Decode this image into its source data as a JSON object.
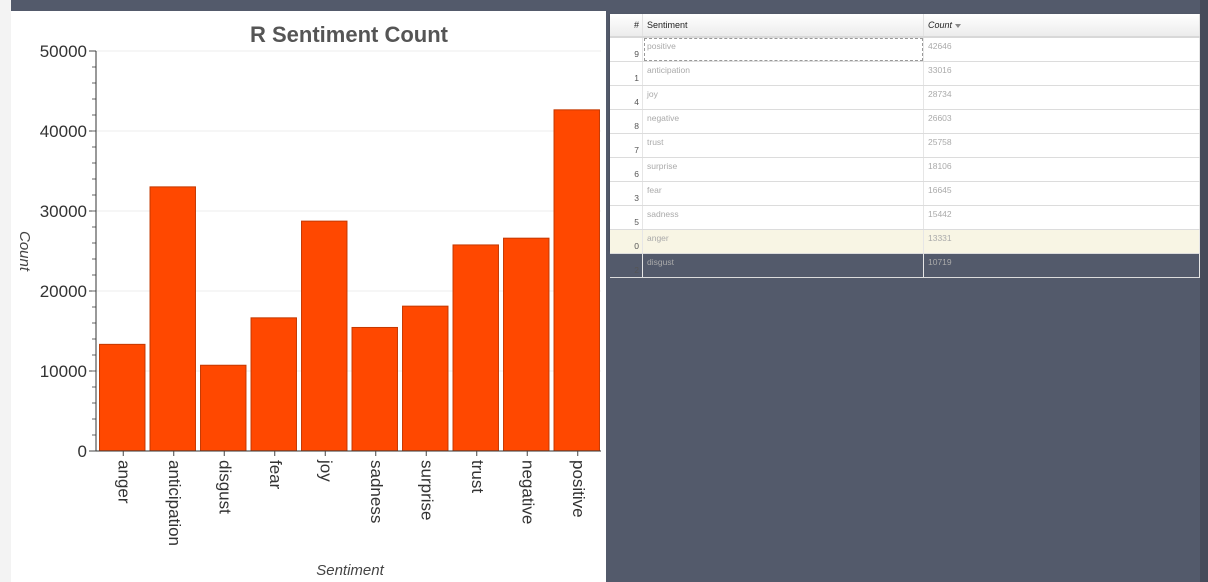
{
  "chart_data": {
    "type": "bar",
    "title": "R Sentiment Count",
    "xlabel": "Sentiment",
    "ylabel": "Count",
    "categories": [
      "anger",
      "anticipation",
      "disgust",
      "fear",
      "joy",
      "sadness",
      "surprise",
      "trust",
      "negative",
      "positive"
    ],
    "values": [
      13331,
      33016,
      10719,
      16645,
      28734,
      15442,
      18106,
      25758,
      26603,
      42646
    ],
    "ylim": [
      0,
      50000
    ],
    "yticks": [
      "0",
      "10000",
      "20000",
      "30000",
      "40000",
      "50000"
    ],
    "grid": true,
    "colors": {
      "bar": "#ff4800"
    }
  },
  "table": {
    "headers": {
      "index": "#",
      "sentiment": "Sentiment",
      "count": "Count"
    },
    "rows": [
      {
        "index": "9",
        "sentiment": "positive",
        "count": "42646"
      },
      {
        "index": "1",
        "sentiment": "anticipation",
        "count": "33016"
      },
      {
        "index": "4",
        "sentiment": "joy",
        "count": "28734"
      },
      {
        "index": "8",
        "sentiment": "negative",
        "count": "26603"
      },
      {
        "index": "7",
        "sentiment": "trust",
        "count": "25758"
      },
      {
        "index": "6",
        "sentiment": "surprise",
        "count": "18106"
      },
      {
        "index": "3",
        "sentiment": "fear",
        "count": "16645"
      },
      {
        "index": "5",
        "sentiment": "sadness",
        "count": "15442"
      },
      {
        "index": "0",
        "sentiment": "anger",
        "count": "13331"
      },
      {
        "index": "2",
        "sentiment": "disgust",
        "count": "10719"
      }
    ],
    "sorted_by": "count",
    "sort_icon": "sort-descending-icon",
    "highlighted_row": "0"
  }
}
